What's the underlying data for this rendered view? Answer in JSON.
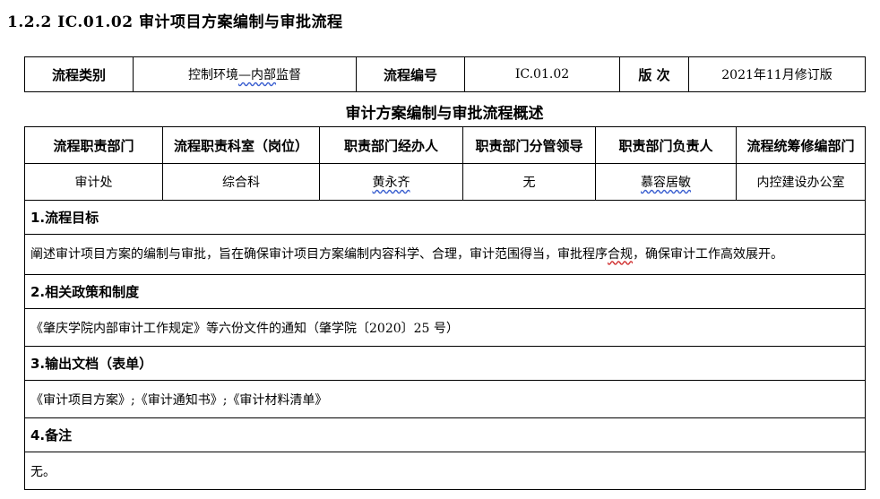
{
  "heading": "1.2.2  IC.01.02 审计项目方案编制与审批流程",
  "meta": {
    "category_label": "流程类别",
    "category_value_a": "控制环境",
    "category_value_b": "—内部",
    "category_value_c": "监督",
    "code_label": "流程编号",
    "code_value": "IC.01.02",
    "version_label": "版  次",
    "version_value": "2021年11月修订版"
  },
  "overview_title": "审计方案编制与审批流程概述",
  "dept": {
    "headers": [
      "流程职责部门",
      "流程职责科室（岗位）",
      "职责部门经办人",
      "职责部门分管领导",
      "职责部门负责人",
      "流程统筹修编部门"
    ],
    "values": [
      "审计处",
      "综合科",
      "黄永齐",
      "无",
      "慕容居敏",
      "内控建设办公室"
    ]
  },
  "sections": {
    "goal_title": "1.流程目标",
    "goal_text_a": "阐述审计项目方案的编制与审批，旨在确保审计项目方案编制内容科学、合理，审计范围得当，审批程序",
    "goal_text_b": "合规",
    "goal_text_c": "，确保审计工作高效展开。",
    "policy_title": "2.相关政策和制度",
    "policy_text": "《肇庆学院内部审计工作规定》等六份文件的通知（肇学院〔2020〕25 号）",
    "output_title": "3.输出文档（表单）",
    "output_text": "《审计项目方案》;《审计通知书》;《审计材料清单》",
    "remark_title": "4.备注",
    "remark_text": "无。"
  }
}
